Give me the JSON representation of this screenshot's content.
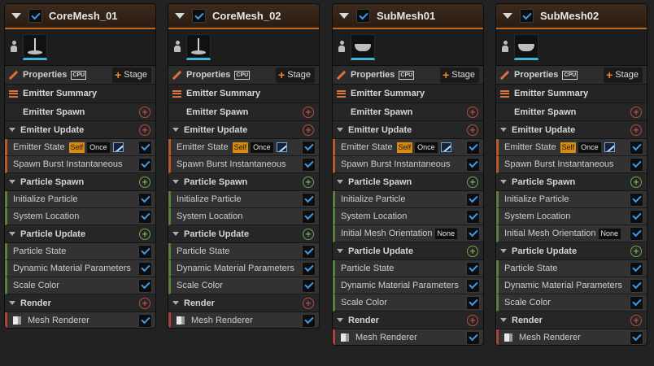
{
  "emitters": [
    {
      "title": "CoreMesh_01",
      "properties_label": "Properties",
      "target": "CPU",
      "stage_label": "Stage",
      "summary_label": "Emitter Summary",
      "spawn_label": "Emitter Spawn",
      "emitter_update_label": "Emitter Update",
      "emitter_state": {
        "label": "Emitter State",
        "scope": "Self",
        "loop": "Once"
      },
      "spawn_burst": "Spawn Burst Instantaneous",
      "particle_spawn_label": "Particle Spawn",
      "spawn_modules": [
        "Initialize Particle",
        "System Location"
      ],
      "particle_update_label": "Particle Update",
      "update_modules": [
        "Particle State",
        "Dynamic Material Parameters",
        "Scale Color"
      ],
      "render_label": "Render",
      "renderer": "Mesh Renderer"
    },
    {
      "title": "CoreMesh_02",
      "properties_label": "Properties",
      "target": "CPU",
      "stage_label": "Stage",
      "summary_label": "Emitter Summary",
      "spawn_label": "Emitter Spawn",
      "emitter_update_label": "Emitter Update",
      "emitter_state": {
        "label": "Emitter State",
        "scope": "Self",
        "loop": "Once"
      },
      "spawn_burst": "Spawn Burst Instantaneous",
      "particle_spawn_label": "Particle Spawn",
      "spawn_modules": [
        "Initialize Particle",
        "System Location"
      ],
      "particle_update_label": "Particle Update",
      "update_modules": [
        "Particle State",
        "Dynamic Material Parameters",
        "Scale Color"
      ],
      "render_label": "Render",
      "renderer": "Mesh Renderer"
    },
    {
      "title": "SubMesh01",
      "properties_label": "Properties",
      "target": "CPU",
      "stage_label": "Stage",
      "summary_label": "Emitter Summary",
      "spawn_label": "Emitter Spawn",
      "emitter_update_label": "Emitter Update",
      "emitter_state": {
        "label": "Emitter State",
        "scope": "Self",
        "loop": "Once"
      },
      "spawn_burst": "Spawn Burst Instantaneous",
      "particle_spawn_label": "Particle Spawn",
      "spawn_modules": [
        "Initialize Particle",
        "System Location"
      ],
      "mesh_orientation": {
        "label": "Initial Mesh Orientation",
        "value": "None"
      },
      "particle_update_label": "Particle Update",
      "update_modules": [
        "Particle State",
        "Dynamic Material Parameters",
        "Scale Color"
      ],
      "render_label": "Render",
      "renderer": "Mesh Renderer"
    },
    {
      "title": "SubMesh02",
      "properties_label": "Properties",
      "target": "CPU",
      "stage_label": "Stage",
      "summary_label": "Emitter Summary",
      "spawn_label": "Emitter Spawn",
      "emitter_update_label": "Emitter Update",
      "emitter_state": {
        "label": "Emitter State",
        "scope": "Self",
        "loop": "Once"
      },
      "spawn_burst": "Spawn Burst Instantaneous",
      "particle_spawn_label": "Particle Spawn",
      "spawn_modules": [
        "Initialize Particle",
        "System Location"
      ],
      "mesh_orientation": {
        "label": "Initial Mesh Orientation",
        "value": "None"
      },
      "particle_update_label": "Particle Update",
      "update_modules": [
        "Particle State",
        "Dynamic Material Parameters",
        "Scale Color"
      ],
      "render_label": "Render",
      "renderer": "Mesh Renderer"
    }
  ],
  "icons": {
    "expand": "triangle-down-icon",
    "enabled": "checkbox-checked-icon",
    "preview": "mesh-preview-thumbnail",
    "add": "plus-circle-icon",
    "renderer": "cube-icon",
    "curve": "curve-icon"
  },
  "colors": {
    "accent": "#c2661e",
    "checkbox": "#3d9cf0",
    "update_group": "#6fa34e",
    "render_group": "#a8443c",
    "self_badge": "#d88a0f",
    "preview_underline": "#3ab8d8"
  }
}
